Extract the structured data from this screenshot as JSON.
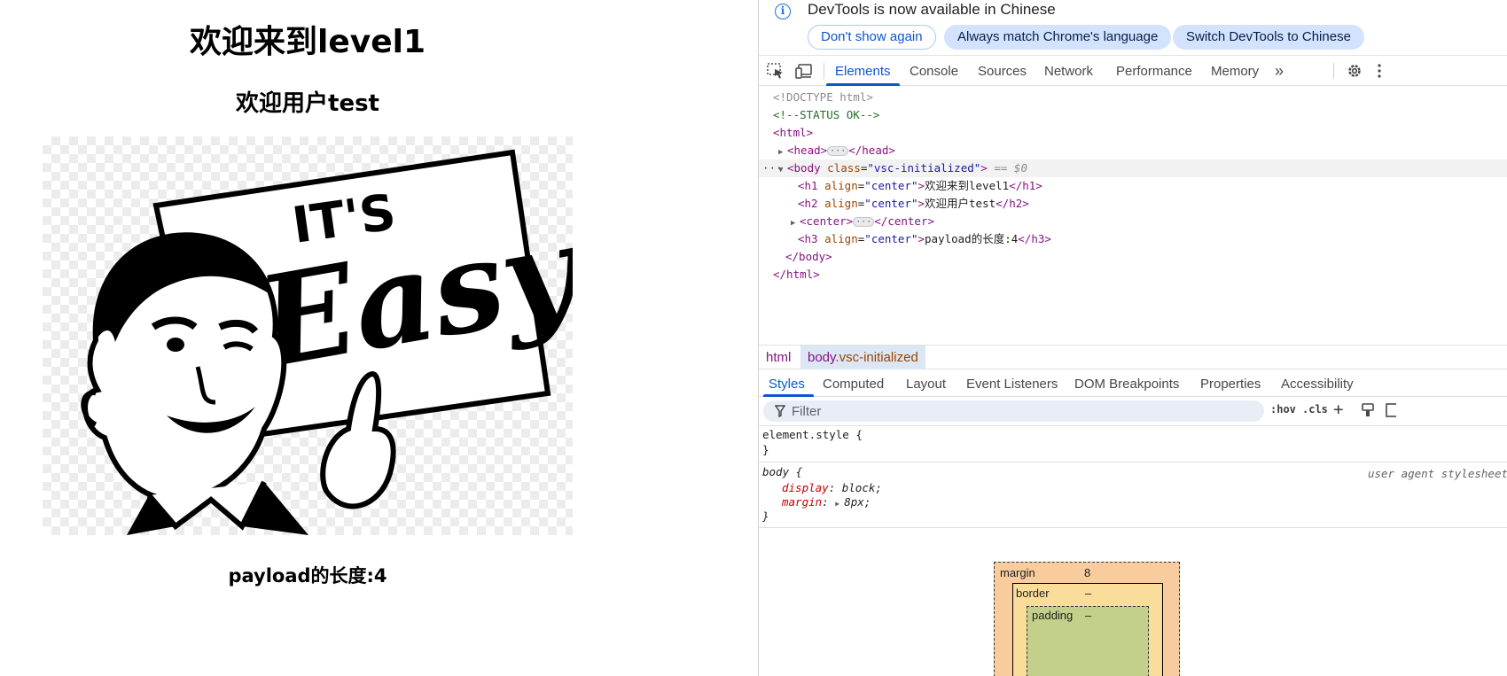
{
  "page": {
    "h1": "欢迎来到level1",
    "h2": "欢迎用户test",
    "h3": "payload的长度:4",
    "image": {
      "sign_line1": "IT'S",
      "sign_line2": "Easy"
    }
  },
  "devtools": {
    "infobar": {
      "message": "DevTools is now available in Chinese",
      "buttons": [
        "Don't show again",
        "Always match Chrome's language",
        "Switch DevTools to Chinese"
      ]
    },
    "tabs": [
      "Elements",
      "Console",
      "Sources",
      "Network",
      "Performance",
      "Memory"
    ],
    "active_tab": "Elements",
    "dom": {
      "doctype": "<!DOCTYPE html>",
      "comment": "<!--STATUS OK-->",
      "html_open": "<html>",
      "head_open": "<head>",
      "head_close": "</head>",
      "body_open": "<body",
      "attr_class": "class",
      "body_class": "vsc-initialized",
      "body_end": ">",
      "dollar_zero": "== $0",
      "h1_open": "<h1",
      "h2_open": "<h2",
      "h3_open": "<h3",
      "attr_align": "align",
      "align_val": "center",
      "tag_end": ">",
      "h1_text": "欢迎来到level1",
      "h1_close": "</h1>",
      "h2_text": "欢迎用户test",
      "h2_close": "</h2>",
      "center_open": "<center>",
      "center_close": "</center>",
      "h3_text": "payload的长度:4",
      "h3_close": "</h3>",
      "body_close": "</body>",
      "html_close": "</html>",
      "eq": "=",
      "quote": "\"",
      "ellipsis": "···",
      "row_dots": "···"
    },
    "breadcrumbs": {
      "html": "html",
      "body_tag": "body",
      "body_class": ".vsc-initialized"
    },
    "subtabs": [
      "Styles",
      "Computed",
      "Layout",
      "Event Listeners",
      "DOM Breakpoints",
      "Properties",
      "Accessibility"
    ],
    "active_subtab": "Styles",
    "filter": {
      "placeholder": "Filter",
      "hov": ":hov",
      "cls": ".cls"
    },
    "styles": {
      "element_style_open": "element.style {",
      "close_brace": "}",
      "body_selector": "body {",
      "user_agent": "user agent stylesheet",
      "prop1": "display",
      "val1": "block",
      "prop2": "margin",
      "val2": "8px",
      "colon": ":",
      "semi": ";"
    },
    "box_model": {
      "margin_label": "margin",
      "margin_value": "8",
      "border_label": "border",
      "border_value": "–",
      "padding_label": "padding",
      "padding_value": "–"
    }
  },
  "colors": {
    "accent": "#0b57d0",
    "tag": "#881280",
    "attribute": "#994500",
    "attribute_value": "#1a1aa6",
    "comment": "#236e25"
  }
}
